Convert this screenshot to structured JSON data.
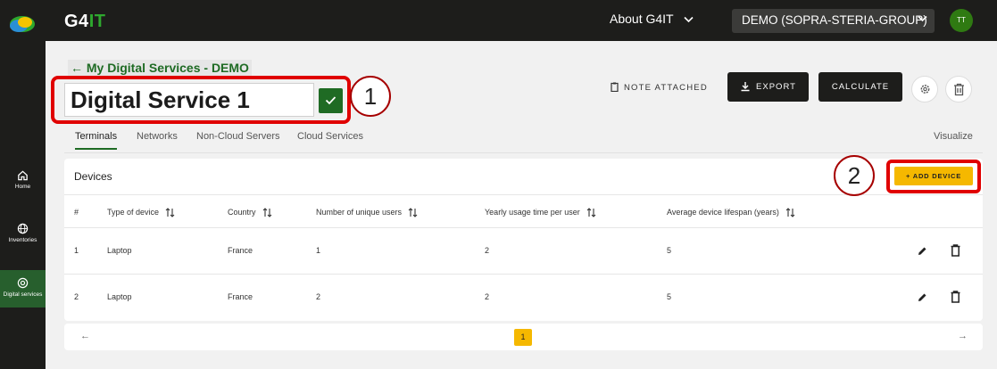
{
  "app": {
    "brand_main": "G4",
    "brand_accent": "IT"
  },
  "sidebar": {
    "items": [
      {
        "label": "Home",
        "icon": "home-icon"
      },
      {
        "label": "Inventories",
        "icon": "globe-icon"
      },
      {
        "label": "Digital services",
        "icon": "at-icon"
      }
    ],
    "active": "Digital services"
  },
  "topbar": {
    "about_label": "About G4IT",
    "org_label": "DEMO (SOPRA-STERIA-GROUP)",
    "avatar_initials": "TT"
  },
  "header": {
    "back_label": "← My Digital Services - DEMO",
    "service_name": "Digital Service 1",
    "annotation_1": "1",
    "annotation_2": "2",
    "note_label": "NOTE ATTACHED",
    "export_label": "EXPORT",
    "calculate_label": "CALCULATE"
  },
  "tabs": {
    "items": [
      "Terminals",
      "Networks",
      "Non-Cloud Servers",
      "Cloud Services"
    ],
    "active": "Terminals",
    "visualize_label": "Visualize"
  },
  "devices": {
    "title": "Devices",
    "add_label": "+ ADD DEVICE",
    "columns": [
      "#",
      "Type of device",
      "Country",
      "Number of unique users",
      "Yearly usage time per user",
      "Average device lifespan (years)"
    ],
    "rows": [
      [
        "1",
        "Laptop",
        "France",
        "1",
        "2",
        "5"
      ],
      [
        "2",
        "Laptop",
        "France",
        "2",
        "2",
        "5"
      ]
    ]
  },
  "pagination": {
    "prev": "←",
    "next": "→",
    "current_page": "1"
  },
  "colors": {
    "accent_green": "#1f6b24",
    "brand_green": "#2ea82e",
    "yellow": "#f5b800",
    "dark": "#1d1d1b",
    "annotation_red": "#e00000"
  }
}
